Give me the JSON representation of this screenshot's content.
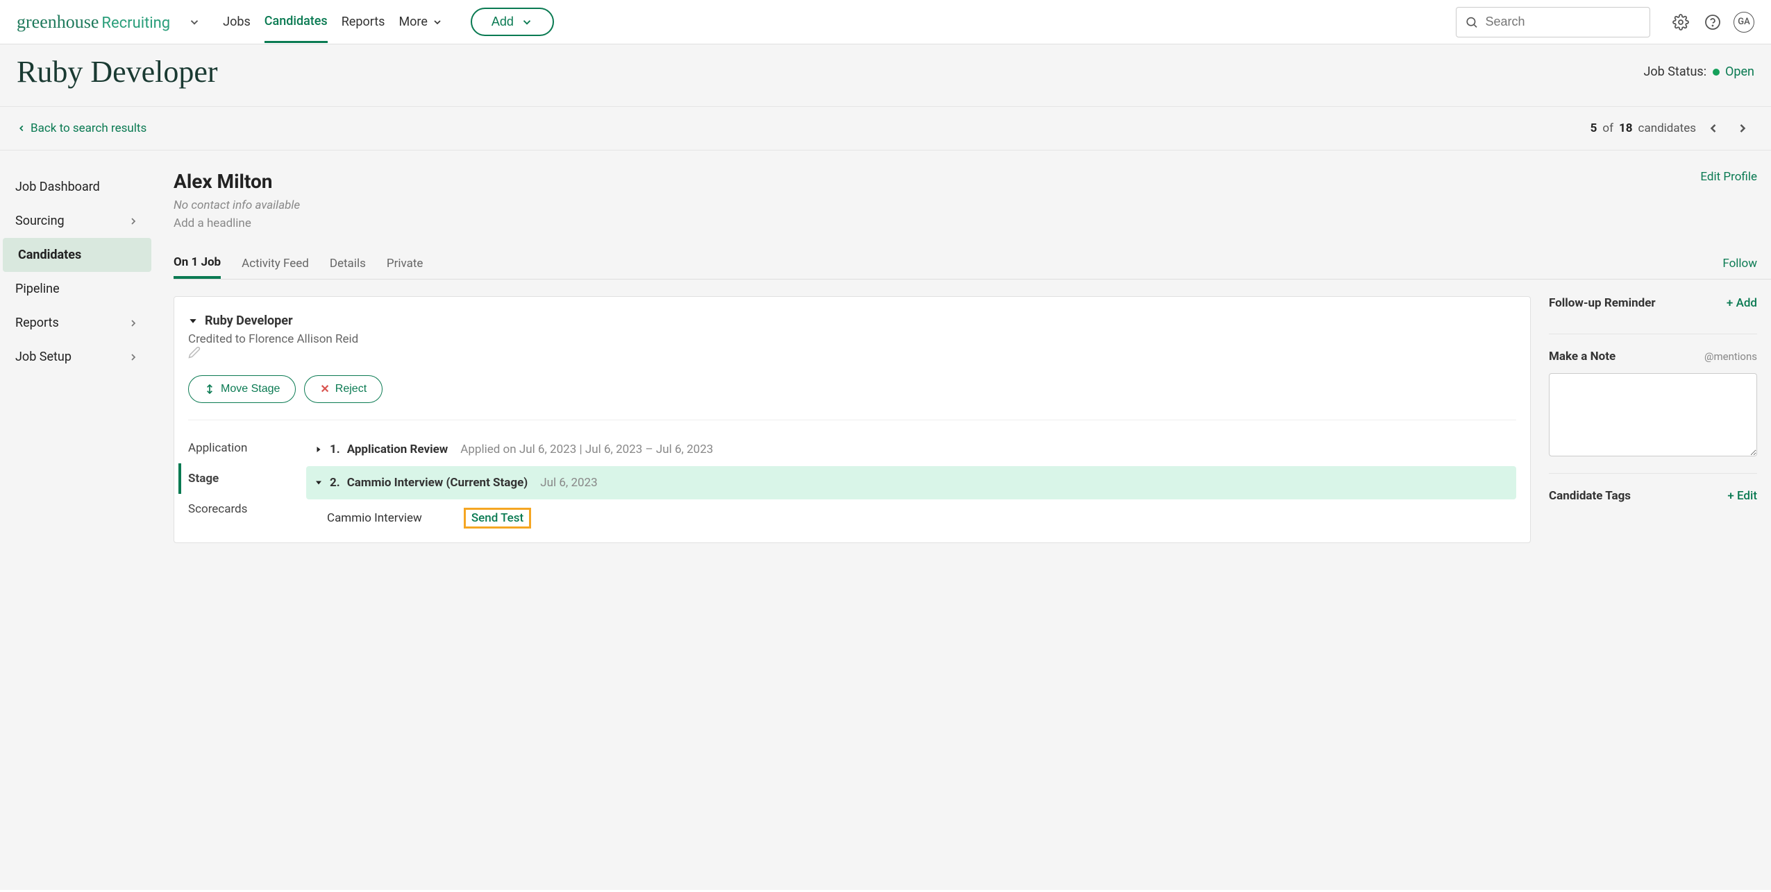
{
  "logo": {
    "brand": "greenhouse",
    "product": "Recruiting"
  },
  "nav": {
    "items": [
      "Jobs",
      "Candidates",
      "Reports",
      "More"
    ],
    "add_label": "Add"
  },
  "search": {
    "placeholder": "Search"
  },
  "avatar_initials": "GA",
  "page": {
    "title": "Ruby Developer",
    "status_label": "Job Status:",
    "status_value": "Open"
  },
  "back_link": "Back to search results",
  "pager": {
    "current": "5",
    "of_label": "of",
    "total": "18",
    "noun": "candidates"
  },
  "sidebar_items": [
    {
      "label": "Job Dashboard",
      "chev": false,
      "active": false
    },
    {
      "label": "Sourcing",
      "chev": true,
      "active": false
    },
    {
      "label": "Candidates",
      "chev": false,
      "active": true
    },
    {
      "label": "Pipeline",
      "chev": false,
      "active": false
    },
    {
      "label": "Reports",
      "chev": true,
      "active": false
    },
    {
      "label": "Job Setup",
      "chev": true,
      "active": false
    }
  ],
  "candidate": {
    "name": "Alex Milton",
    "no_contact": "No contact info available",
    "add_headline": "Add a headline",
    "edit_profile": "Edit Profile",
    "follow": "Follow",
    "tabs": [
      "On 1 Job",
      "Activity Feed",
      "Details",
      "Private"
    ]
  },
  "job_card": {
    "name": "Ruby Developer",
    "credited_prefix": "Credited to ",
    "credited_name": "Florence Allison Reid",
    "move_stage": "Move Stage",
    "reject": "Reject",
    "stage_nav": [
      "Application",
      "Stage",
      "Scorecards"
    ],
    "stage1": {
      "num": "1.",
      "title": "Application Review",
      "dates": "Applied on Jul 6, 2023 | Jul 6, 2023 – Jul 6, 2023"
    },
    "stage2": {
      "num": "2.",
      "title": "Cammio Interview (Current Stage)",
      "date": "Jul 6, 2023"
    },
    "substage": {
      "title": "Cammio Interview",
      "action": "Send Test"
    }
  },
  "right": {
    "followup_title": "Follow-up Reminder",
    "followup_action": "+ Add",
    "note_title": "Make a Note",
    "mentions": "@mentions",
    "tags_title": "Candidate Tags",
    "tags_action": "+ Edit"
  }
}
